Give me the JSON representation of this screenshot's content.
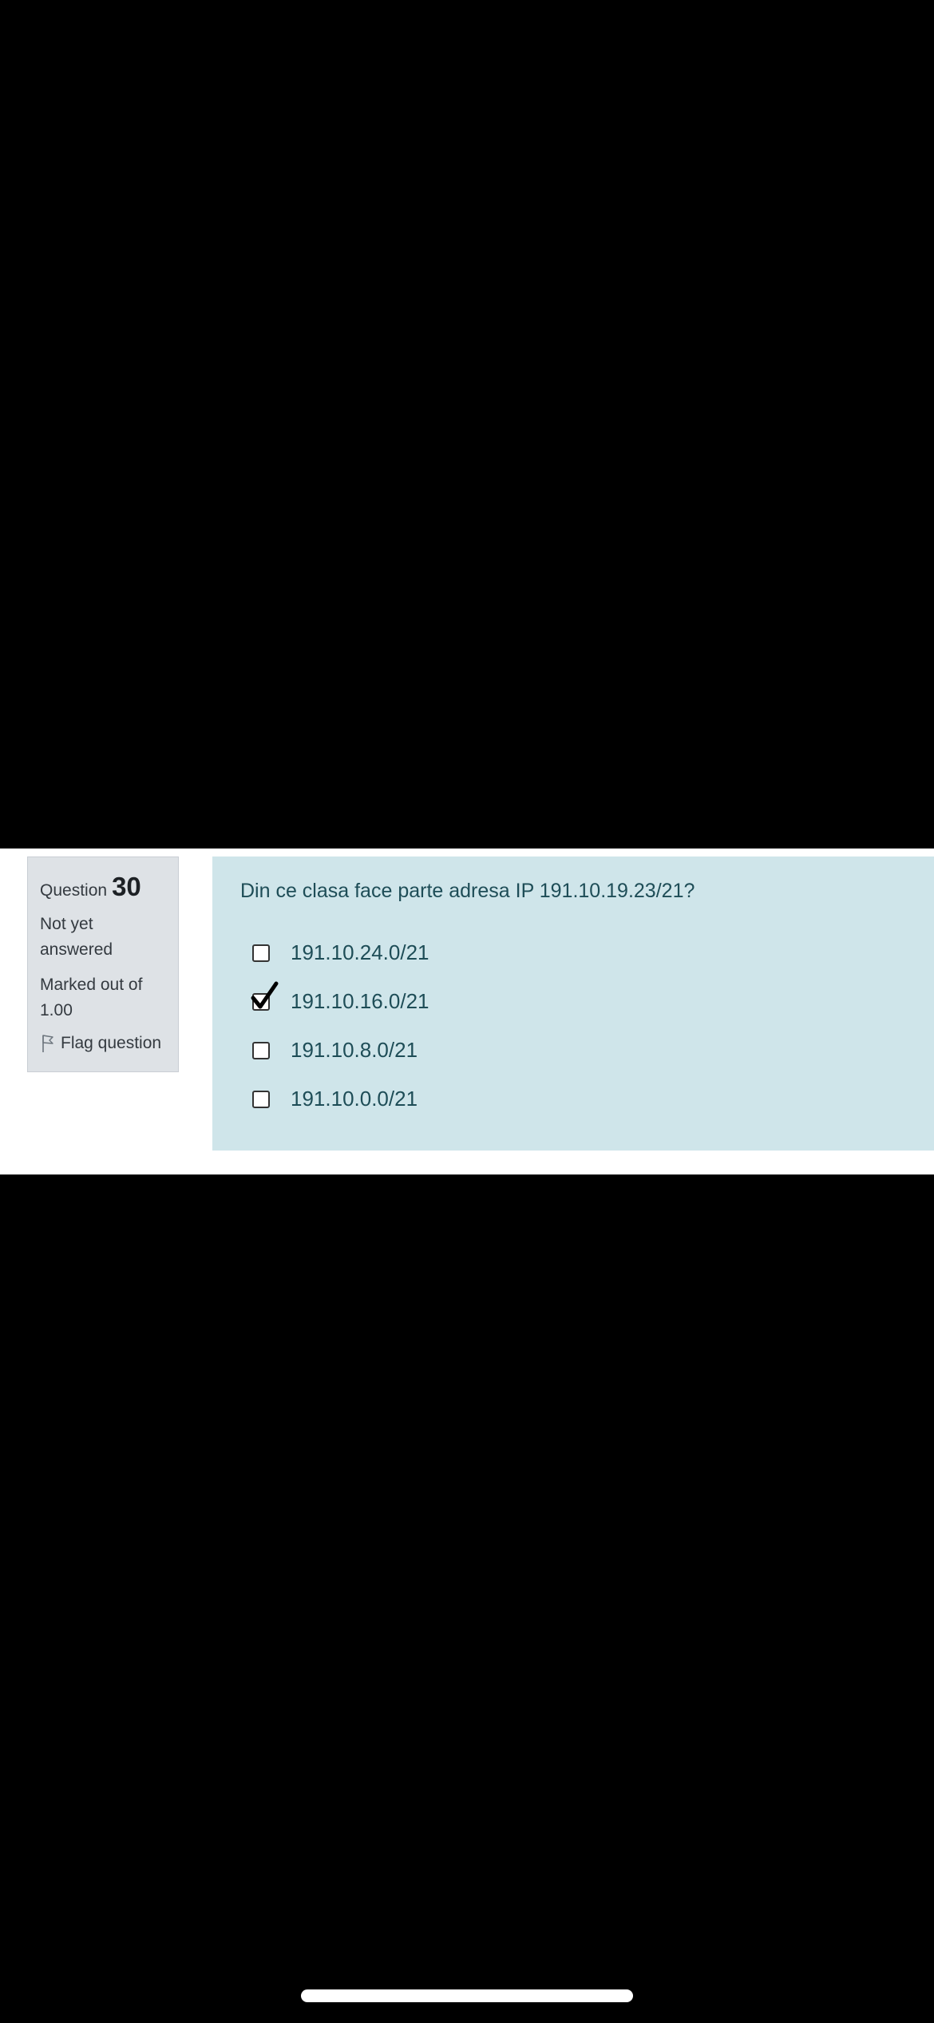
{
  "info": {
    "question_label": "Question",
    "question_number": "30",
    "state": "Not yet answered",
    "grade_label": "Marked out of",
    "grade_value": "1.00",
    "flag_label": "Flag question"
  },
  "question": {
    "text": "Din ce clasa face parte adresa IP 191.10.19.23/21?",
    "answers": [
      {
        "label": "191.10.24.0/21",
        "checked": false
      },
      {
        "label": "191.10.16.0/21",
        "checked": true
      },
      {
        "label": "191.10.8.0/21",
        "checked": false
      },
      {
        "label": "191.10.0.0/21",
        "checked": false
      }
    ]
  },
  "colors": {
    "content_bg": "#cfe5ea",
    "info_bg": "#dee2e6",
    "text_teal": "#1e4d57"
  },
  "icons": {
    "flag": "flag-icon",
    "check": "checkmark-icon"
  }
}
